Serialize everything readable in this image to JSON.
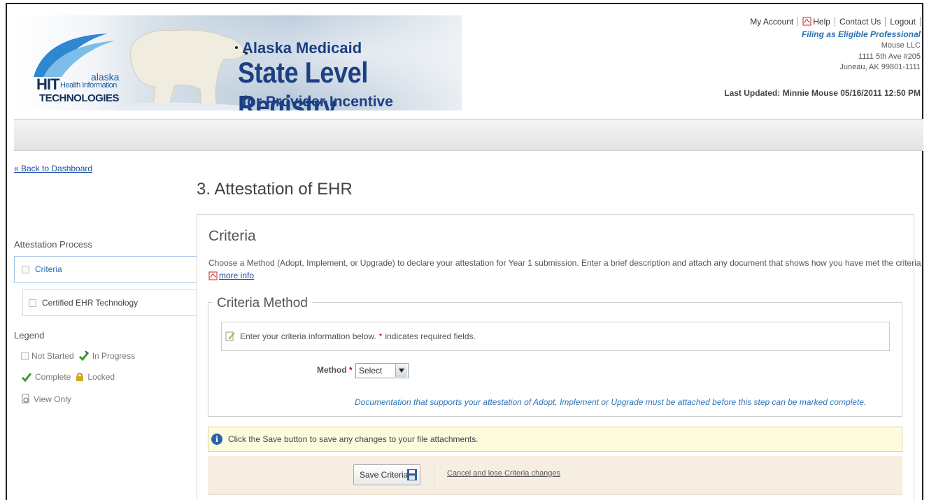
{
  "header": {
    "brand_line1": "Alaska Medicaid",
    "brand_line2": "State Level Registry",
    "brand_line3": "for Provider Incentive Payments",
    "logo": {
      "hit": "HIT",
      "alaska": "alaska",
      "health_info": "Health Information",
      "technologies": "TECHNOLOGIES"
    },
    "links": {
      "my_account": "My Account",
      "help": "Help",
      "contact_us": "Contact Us",
      "logout": "Logout"
    },
    "filing_as": "Filing as Eligible Professional",
    "org_name": "Mouse LLC",
    "address_line1": "1111 5th Ave #205",
    "address_line2": "Juneau, AK 99801-1111",
    "last_updated": "Last Updated: Minnie Mouse 05/16/2011 12:50 PM"
  },
  "sidebar": {
    "back_link": "« Back to Dashboard",
    "process_title": "Attestation Process",
    "steps": [
      {
        "label": "Criteria"
      },
      {
        "label": "Certified EHR Technology"
      }
    ],
    "legend_title": "Legend",
    "legend": {
      "not_started": "Not Started",
      "in_progress": "In Progress",
      "complete": "Complete",
      "locked": "Locked",
      "view_only": "View Only"
    }
  },
  "main": {
    "page_title": "3. Attestation of EHR",
    "section_title": "Criteria",
    "description": "Choose a Method (Adopt, Implement, or Upgrade) to declare your attestation for Year 1 submission. Enter a brief description and attach any document that shows how you have met the criteria.",
    "more_info": "more info",
    "fieldset_legend": "Criteria Method",
    "info_text_before": "Enter your criteria information below.",
    "required_star": "*",
    "info_text_after": "indicates required fields.",
    "method_label": "Method",
    "method_value": "Select",
    "doc_note": "Documentation that supports your attestation of Adopt, Implement or Upgrade must be attached before this step can be marked complete.",
    "save_notice": "Click the Save button to save any changes to your file attachments.",
    "save_button": "Save Criteria",
    "cancel_link": "Cancel and lose Criteria changes"
  },
  "colors": {
    "brand_blue": "#1d3f83",
    "link_blue": "#1a4aa0",
    "note_blue": "#2d73b9",
    "notice_bg": "#fcfbdc",
    "action_bg": "#f7eee2"
  }
}
